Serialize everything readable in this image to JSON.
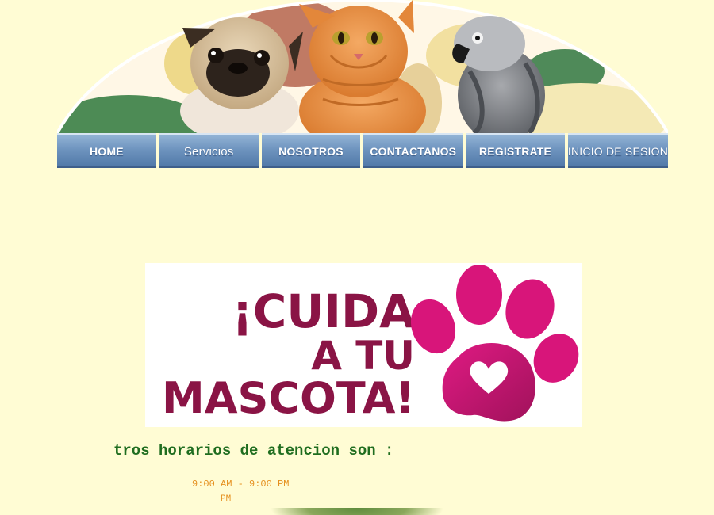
{
  "nav": {
    "items": [
      {
        "label": "HOME"
      },
      {
        "label": "Servicios"
      },
      {
        "label": "NOSOTROS"
      },
      {
        "label": "CONTACTANOS"
      },
      {
        "label": "REGISTRATE"
      },
      {
        "label": "INICIO DE SESION"
      }
    ]
  },
  "banner": {
    "animals": [
      "pug-dog",
      "orange-cat",
      "grey-parrot"
    ]
  },
  "promo": {
    "line1": "¡CUIDA",
    "line2": "A TU",
    "line3": "MASCOTA!",
    "text_color": "#8a1445",
    "paw_color": "#d8157a"
  },
  "hours": {
    "title": "tros horarios de atencion son :",
    "line1": "9:00 AM - 9:00 PM",
    "line2": "PM"
  },
  "colors": {
    "background": "#fffcd4",
    "nav_button": "#6d93be",
    "hours_title": "#1f6d1f",
    "hours_text": "#e58f1e"
  }
}
